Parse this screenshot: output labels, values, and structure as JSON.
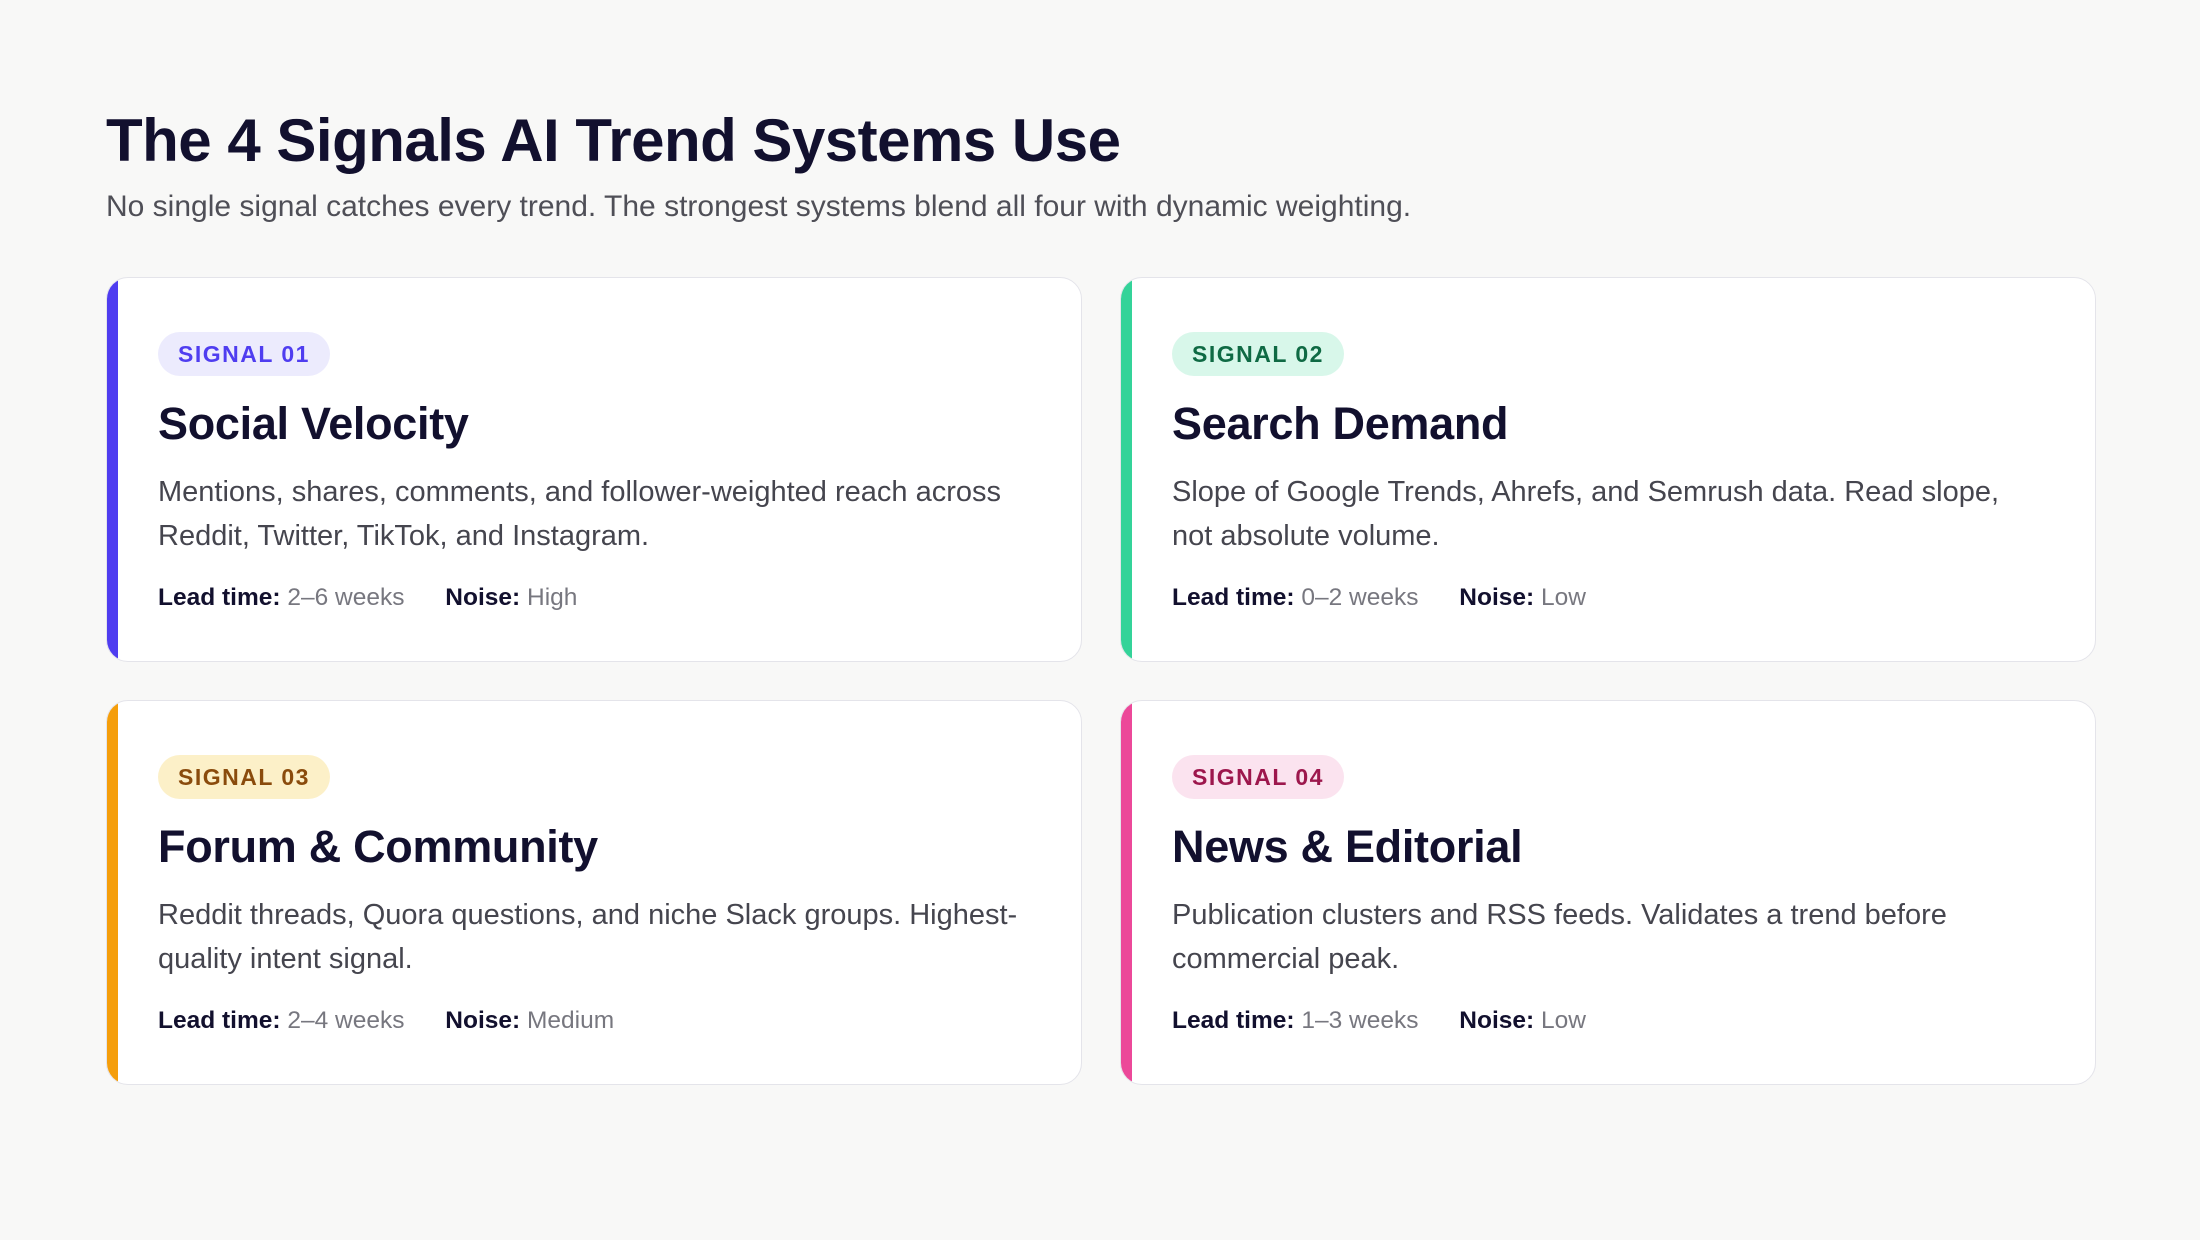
{
  "header": {
    "title": "The 4 Signals AI Trend Systems Use",
    "subtitle": "No single signal catches every trend. The strongest systems blend all four with dynamic weighting."
  },
  "cards": [
    {
      "badge": "SIGNAL 01",
      "title": "Social Velocity",
      "description": "Mentions, shares, comments, and follower-weighted reach across Reddit, Twitter, TikTok, and Instagram.",
      "lead_time_label": "Lead time:",
      "lead_time": "2–6 weeks",
      "noise_label": "Noise:",
      "noise": "High",
      "accent_color": "#4f3df0",
      "badge_bg": "#ecebfd",
      "badge_fg": "#4f3df0"
    },
    {
      "badge": "SIGNAL 02",
      "title": "Search Demand",
      "description": "Slope of Google Trends, Ahrefs, and Semrush data. Read slope, not absolute volume.",
      "lead_time_label": "Lead time:",
      "lead_time": "0–2 weeks",
      "noise_label": "Noise:",
      "noise": "Low",
      "accent_color": "#34d399",
      "badge_bg": "#d8f7ea",
      "badge_fg": "#0f6a44"
    },
    {
      "badge": "SIGNAL 03",
      "title": "Forum & Community",
      "description": "Reddit threads, Quora questions, and niche Slack groups. Highest-quality intent signal.",
      "lead_time_label": "Lead time:",
      "lead_time": "2–4 weeks",
      "noise_label": "Noise:",
      "noise": "Medium",
      "accent_color": "#f59e0b",
      "badge_bg": "#fcf0c8",
      "badge_fg": "#8a4b0c"
    },
    {
      "badge": "SIGNAL 04",
      "title": "News & Editorial",
      "description": "Publication clusters and RSS feeds. Validates a trend before commercial peak.",
      "lead_time_label": "Lead time:",
      "lead_time": "1–3 weeks",
      "noise_label": "Noise:",
      "noise": "Low",
      "accent_color": "#ec4899",
      "badge_bg": "#fbe3ef",
      "badge_fg": "#9d174d"
    }
  ]
}
